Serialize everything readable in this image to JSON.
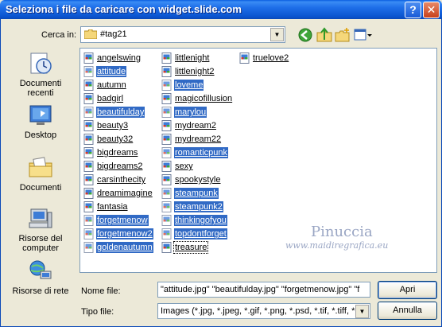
{
  "window": {
    "title": "Seleziona i file da caricare con widget.slide.com"
  },
  "toolbar": {
    "lookin_label": "Cerca in:",
    "lookin_value": "#tag21"
  },
  "places": [
    {
      "label": "Documenti recenti",
      "icon": "recent-documents-icon"
    },
    {
      "label": "Desktop",
      "icon": "desktop-icon"
    },
    {
      "label": "Documenti",
      "icon": "documents-icon"
    },
    {
      "label": "Risorse del computer",
      "icon": "my-computer-icon"
    },
    {
      "label": "Risorse di rete",
      "icon": "network-icon"
    }
  ],
  "files": {
    "col1": [
      {
        "name": "angelswing",
        "selected": false
      },
      {
        "name": "attitude",
        "selected": true
      },
      {
        "name": "autumn",
        "selected": false
      },
      {
        "name": "badgirl",
        "selected": false
      },
      {
        "name": "beautifulday",
        "selected": true
      },
      {
        "name": "beauty3",
        "selected": false
      },
      {
        "name": "beauty32",
        "selected": false
      },
      {
        "name": "bigdreams",
        "selected": false
      },
      {
        "name": "bigdreams2",
        "selected": false
      },
      {
        "name": "carsinthecity",
        "selected": false
      },
      {
        "name": "dreamimagine",
        "selected": false
      },
      {
        "name": "fantasia",
        "selected": false
      },
      {
        "name": "forgetmenow",
        "selected": true
      },
      {
        "name": "forgetmenow2",
        "selected": true
      },
      {
        "name": "goldenautumn",
        "selected": true
      }
    ],
    "col2": [
      {
        "name": "littlenight",
        "selected": false
      },
      {
        "name": "littlenight2",
        "selected": false
      },
      {
        "name": "loveme",
        "selected": true
      },
      {
        "name": "magicofillusion",
        "selected": false
      },
      {
        "name": "marylou",
        "selected": true
      },
      {
        "name": "mydream2",
        "selected": false
      },
      {
        "name": "mydream22",
        "selected": false
      },
      {
        "name": "romanticpunk",
        "selected": true
      },
      {
        "name": "sexy",
        "selected": false
      },
      {
        "name": "spookystyle",
        "selected": false
      },
      {
        "name": "steampunk",
        "selected": true
      },
      {
        "name": "steampunk2",
        "selected": true
      },
      {
        "name": "thinkingofyou",
        "selected": true
      },
      {
        "name": "topdontforget",
        "selected": true
      },
      {
        "name": "treasure",
        "selected": false,
        "focus": true
      }
    ],
    "col3": [
      {
        "name": "truelove2",
        "selected": false
      }
    ]
  },
  "watermark": {
    "name": "Pinuccia",
    "url": "www.maidiregrafica.eu"
  },
  "bottom": {
    "filename_label": "Nome file:",
    "filename_value": "\"attitude.jpg\" \"beautifulday.jpg\" \"forgetmenow.jpg\" \"f",
    "filetype_label": "Tipo file:",
    "filetype_value": "Images (*.jpg, *.jpeg, *.gif, *.png, *.psd, *.tif, *.tiff, *.bm",
    "open_label": "Apri",
    "cancel_label": "Annulla"
  }
}
